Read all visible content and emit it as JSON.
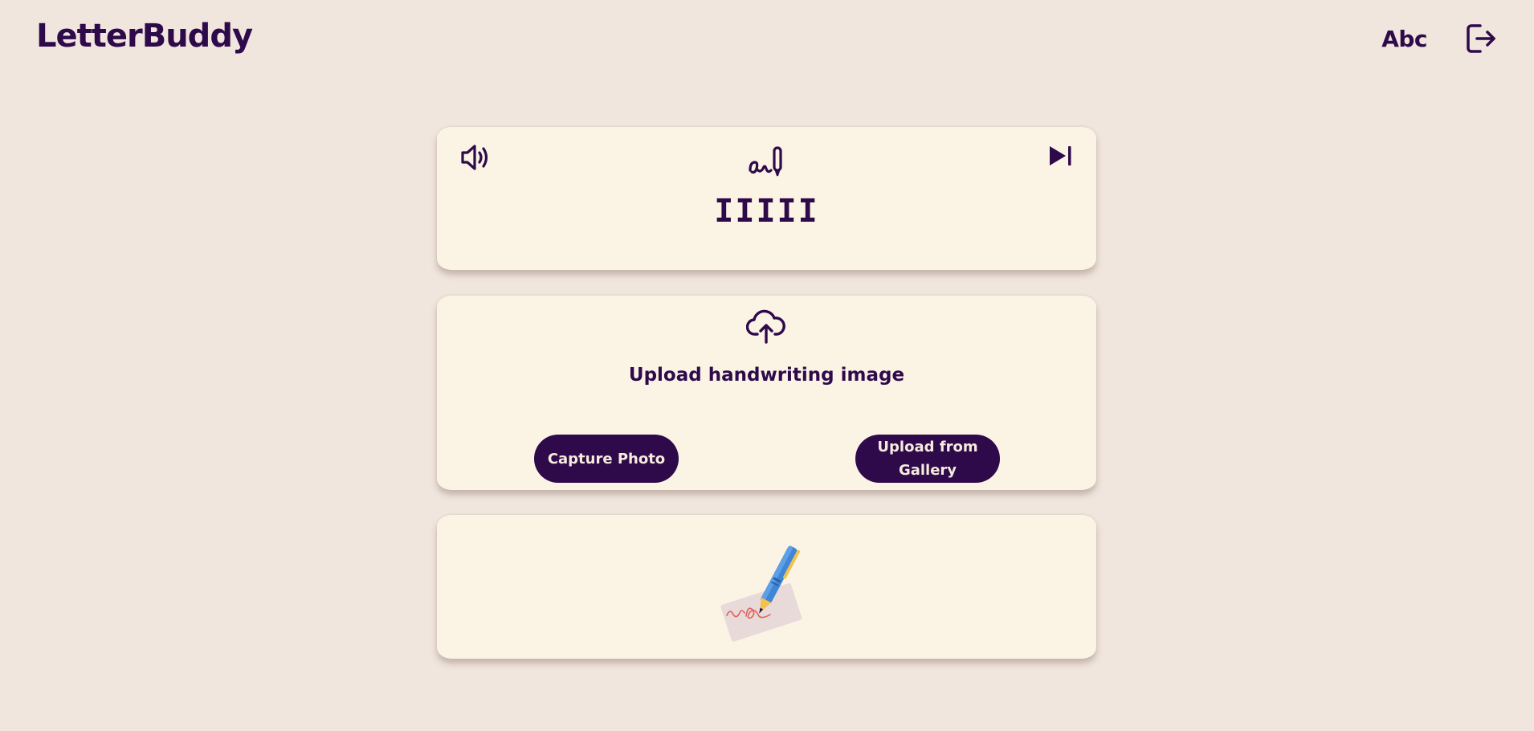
{
  "app": {
    "title": "LetterBuddy"
  },
  "header": {
    "font_toggle_label": "Abc",
    "logout_icon": "logout-icon"
  },
  "practice_card": {
    "speaker_icon": "speaker-icon",
    "write_icon": "handwriting-icon",
    "skip_icon": "skip-next-icon",
    "letter_display": "IIIII"
  },
  "upload_card": {
    "upload_icon": "cloud-upload-icon",
    "label": "Upload handwriting image",
    "capture_button": "Capture Photo",
    "gallery_button": "Upload from Gallery"
  },
  "result_card": {
    "illustration": "pen-writing-illustration"
  },
  "colors": {
    "background": "#F0E6DD",
    "card": "#FBF4E5",
    "primary": "#2E0A4B",
    "button_text": "#F7EBDD"
  }
}
